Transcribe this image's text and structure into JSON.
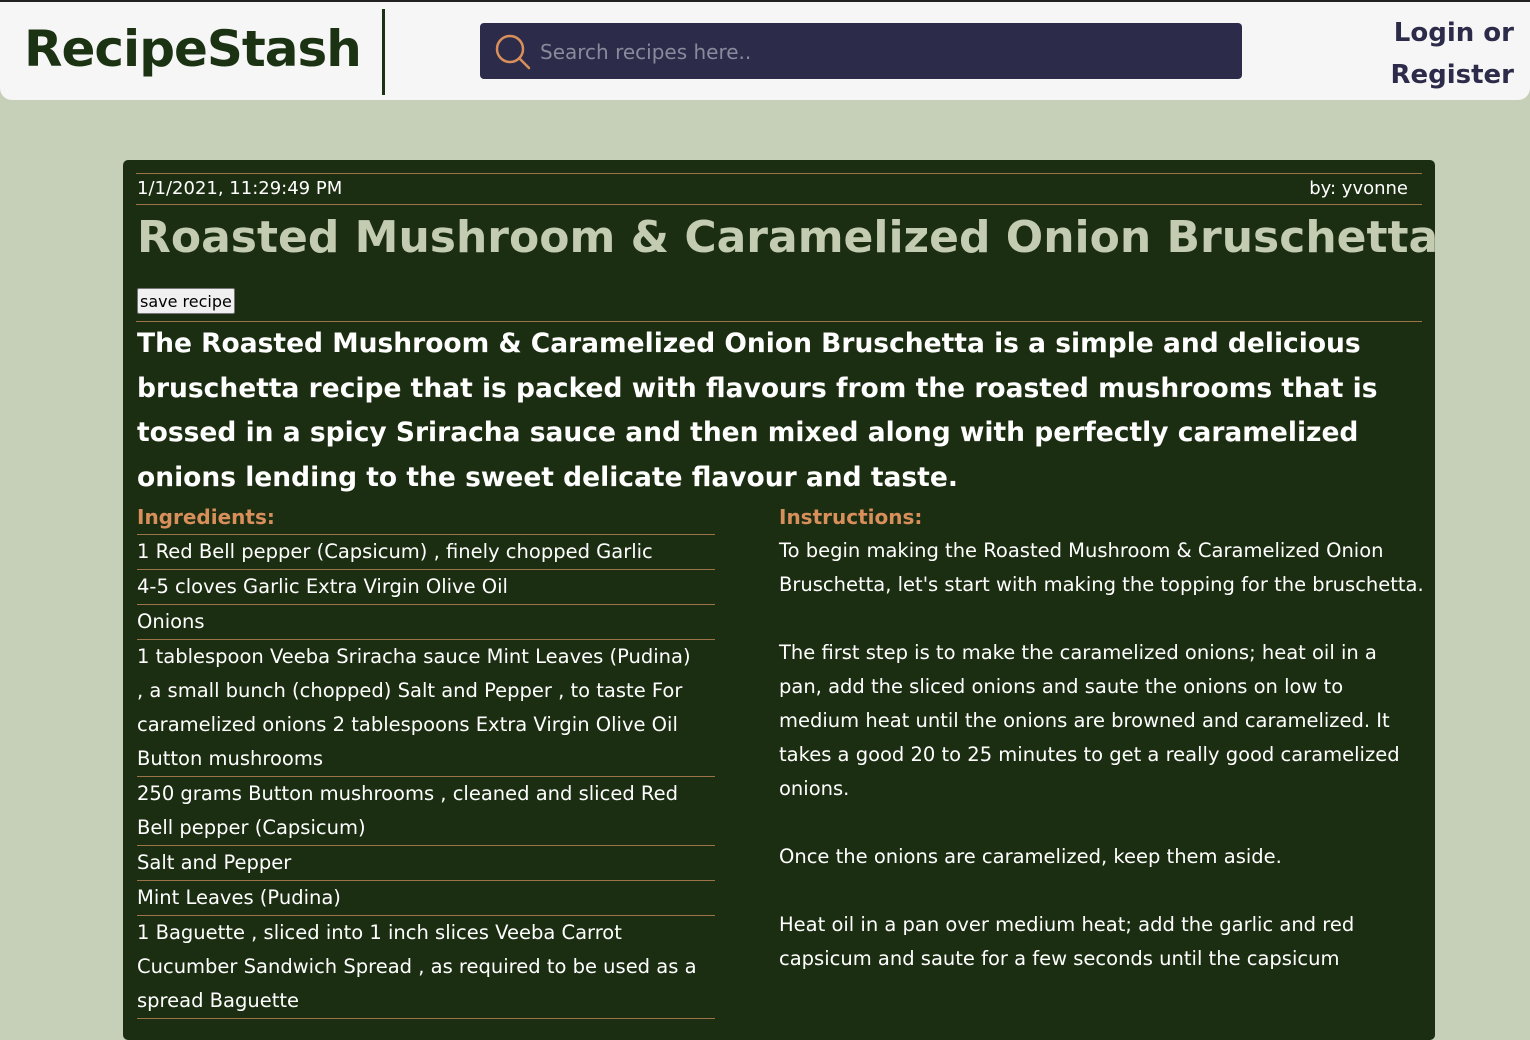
{
  "header": {
    "logo": "RecipeStash",
    "search_placeholder": "Search recipes here..",
    "login_line1": "Login or",
    "login_line2": "Register"
  },
  "recipe": {
    "date": "1/1/2021, 11:29:49 PM",
    "author": "by: yvonne",
    "title": "Roasted Mushroom & Caramelized Onion Bruschetta",
    "save_label": "save recipe",
    "description": "The Roasted Mushroom & Caramelized Onion Bruschetta is a simple and delicious bruschetta recipe that is packed with flavours from the roasted mushrooms that is tossed in a spicy Sriracha sauce and then mixed along with perfectly caramelized onions lending to the sweet delicate flavour and taste.",
    "ingredients_heading": "Ingredients:",
    "ingredients": [
      "1 Red Bell pepper (Capsicum) , finely chopped Garlic",
      "4-5 cloves Garlic Extra Virgin Olive Oil",
      "Onions",
      "1 tablespoon Veeba Sriracha sauce Mint Leaves (Pudina) , a small bunch (chopped) Salt and Pepper , to taste For caramelized onions 2 tablespoons Extra Virgin Olive Oil Button mushrooms",
      "250 grams Button mushrooms , cleaned and sliced Red Bell pepper (Capsicum)",
      "Salt and Pepper",
      "Mint Leaves (Pudina)",
      "1 Baguette , sliced into 1 inch slices Veeba Carrot Cucumber Sandwich Spread , as required to be used as a spread Baguette"
    ],
    "instructions_heading": "Instructions:",
    "instructions": [
      "To begin making the Roasted Mushroom & Caramelized Onion Bruschetta, let's start with making the topping for the bruschetta.",
      "The first step is to make the caramelized onions; heat oil in a pan, add the sliced onions and saute the onions on low to medium heat until the onions are browned and caramelized. It takes a good 20 to 25 minutes to get a really good caramelized onions.",
      "Once the onions are caramelized, keep them aside.",
      "Heat oil in a pan over medium heat; add the garlic and red capsicum and saute for a few seconds until the capsicum"
    ]
  },
  "colors": {
    "background": "#c6d0b8",
    "card": "#1c2e12",
    "accent": "#d88f5b",
    "title": "#c3cbb1",
    "search_bg": "#2c2b49"
  }
}
